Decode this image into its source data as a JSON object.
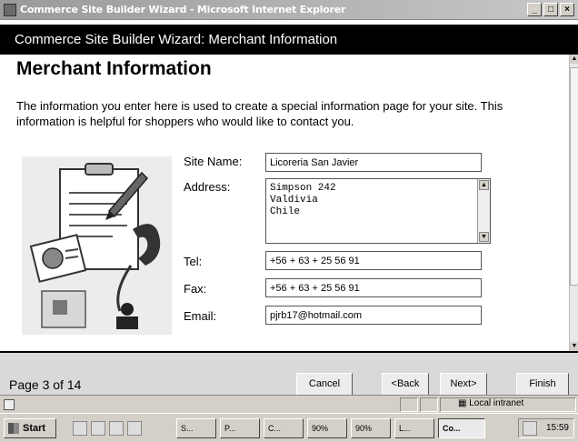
{
  "window": {
    "title": "Commerce Site Builder Wizard - Microsoft Internet Explorer",
    "controls": [
      "_",
      "□",
      "×"
    ]
  },
  "wizard": {
    "header": "Commerce Site Builder Wizard: Merchant Information"
  },
  "page": {
    "heading": "Merchant Information",
    "intro": "The information you enter here is used to create a special information page for your site. This information is helpful for shoppers who would like to contact you."
  },
  "form": {
    "site_name_label": "Site Name:",
    "site_name_value": "Licoreria San Javier",
    "address_label": "Address:",
    "address_value": "Simpson 242\nValdivia\nChile",
    "tel_label": "Tel:",
    "tel_value": "+56 + 63 + 25 56 91",
    "fax_label": "Fax:",
    "fax_value": "+56 + 63 + 25 56 91",
    "email_label": "Email:",
    "email_value": "pjrb17@hotmail.com"
  },
  "footer": {
    "page_indicator": "Page 3 of 14",
    "cancel": "Cancel",
    "back": "<Back",
    "next": "Next>",
    "finish": "Finish"
  },
  "statusbar": {
    "zone": "Local intranet"
  },
  "taskbar": {
    "start": "Start",
    "tasks": [
      "S...",
      "P...",
      "C...",
      "90%",
      "90%",
      "L...",
      "Co..."
    ],
    "clock": "15:59"
  },
  "colors": {
    "header_bg": "#000000",
    "footer_bg": "#d9d9d9",
    "chrome": "#d4d0c8"
  }
}
